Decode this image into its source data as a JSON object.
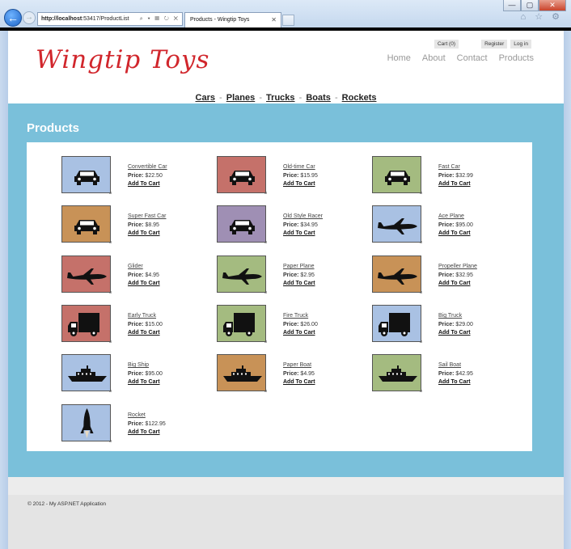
{
  "browser": {
    "address_host": "http://localhost",
    "address_path": ":53417/ProductList",
    "address_tools": "⌕ ▾ ▤ ↻ ✕",
    "tab_title": "Products - Wingtip Toys",
    "tab_close": "✕",
    "win_min": "—",
    "win_max": "▢",
    "win_close": "✕",
    "toolbar_icons": "⌂ ☆ ⚙"
  },
  "header": {
    "logo": "Wingtip Toys",
    "cart": "Cart (0)",
    "register": "Register",
    "login": "Log in",
    "nav": [
      "Home",
      "About",
      "Contact",
      "Products"
    ],
    "categories": [
      "Cars",
      "Planes",
      "Trucks",
      "Boats",
      "Rockets"
    ],
    "category_separator": "-"
  },
  "main": {
    "title": "Products",
    "price_label": "Price:",
    "add_to_cart": "Add To Cart",
    "products": [
      {
        "name": "Convertible Car",
        "price": "$22.50",
        "color": "#a9c1e3",
        "icon": "car-icon"
      },
      {
        "name": "Old-time Car",
        "price": "$15.95",
        "color": "#c5716a",
        "icon": "car-icon"
      },
      {
        "name": "Fast Car",
        "price": "$32.99",
        "color": "#a4bb80",
        "icon": "car-icon"
      },
      {
        "name": "Super Fast Car",
        "price": "$8.95",
        "color": "#c89257",
        "icon": "car-icon"
      },
      {
        "name": "Old Style Racer",
        "price": "$34.95",
        "color": "#9f8fb4",
        "icon": "car-icon"
      },
      {
        "name": "Ace Plane",
        "price": "$95.00",
        "color": "#a9c1e3",
        "icon": "plane-icon"
      },
      {
        "name": "Glider",
        "price": "$4.95",
        "color": "#c5716a",
        "icon": "plane-icon"
      },
      {
        "name": "Paper Plane",
        "price": "$2.95",
        "color": "#a4bb80",
        "icon": "plane-icon"
      },
      {
        "name": "Propeller Plane",
        "price": "$32.95",
        "color": "#c89257",
        "icon": "plane-icon"
      },
      {
        "name": "Early Truck",
        "price": "$15.00",
        "color": "#c5716a",
        "icon": "truck-icon"
      },
      {
        "name": "Fire Truck",
        "price": "$26.00",
        "color": "#a4bb80",
        "icon": "truck-icon"
      },
      {
        "name": "Big Truck",
        "price": "$29.00",
        "color": "#a9c1e3",
        "icon": "truck-icon"
      },
      {
        "name": "Big Ship",
        "price": "$95.00",
        "color": "#a9c1e3",
        "icon": "boat-icon"
      },
      {
        "name": "Paper Boat",
        "price": "$4.95",
        "color": "#c89257",
        "icon": "boat-icon"
      },
      {
        "name": "Sail Boat",
        "price": "$42.95",
        "color": "#a4bb80",
        "icon": "boat-icon"
      },
      {
        "name": "Rocket",
        "price": "$122.95",
        "color": "#a9c1e3",
        "icon": "rocket-icon"
      }
    ]
  },
  "footer": {
    "copyright": "© 2012 - My ASP.NET Application"
  }
}
